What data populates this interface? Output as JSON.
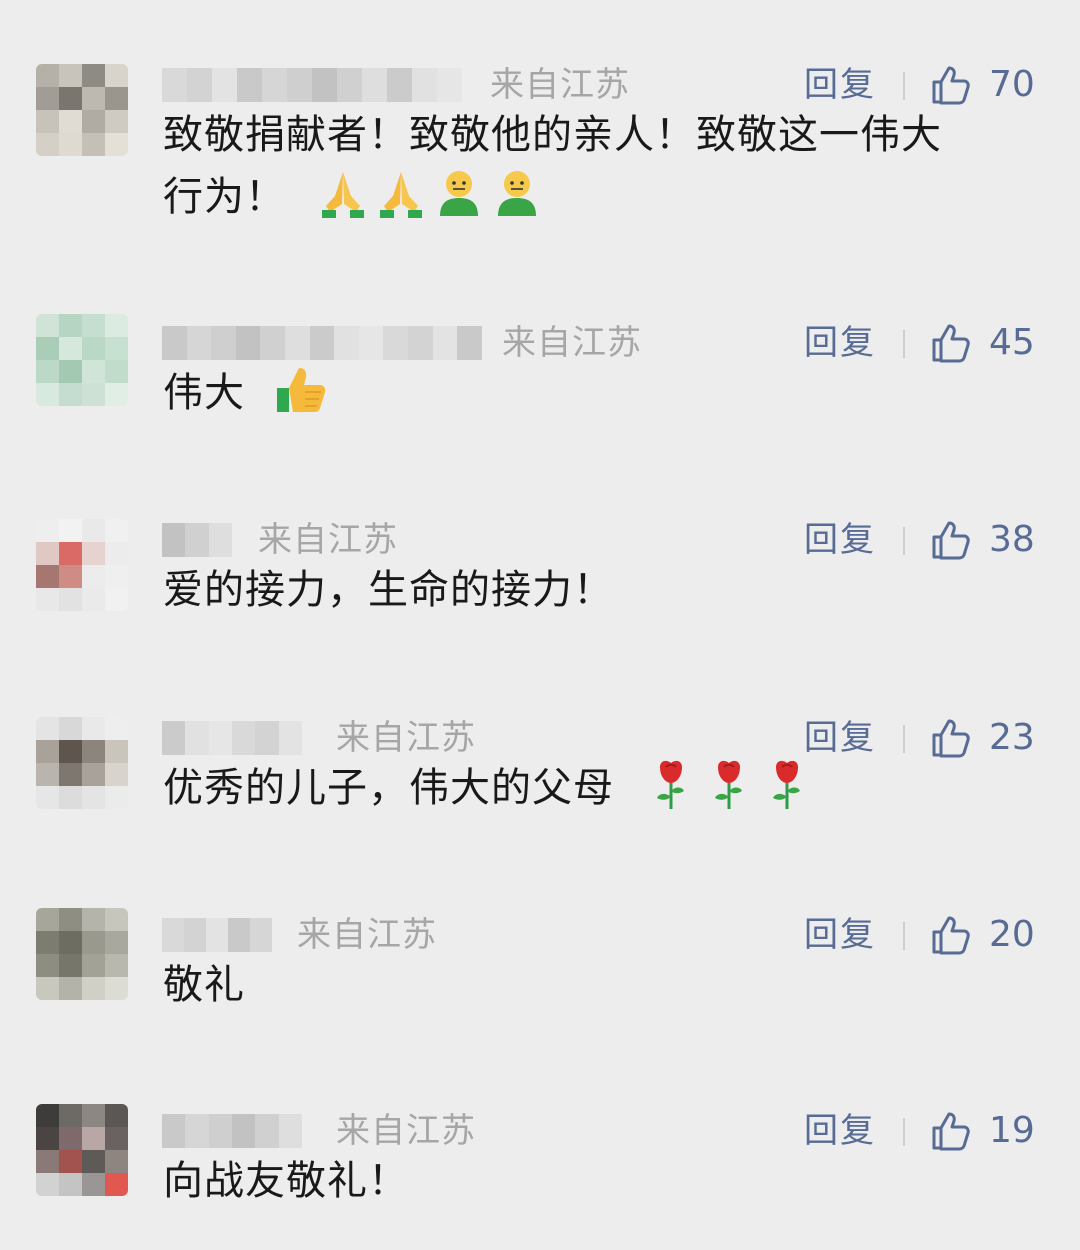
{
  "comments": [
    {
      "location": "来自江苏",
      "reply_label": "回复",
      "likes": "70",
      "text_parts": [
        "致敬捐献者！致敬他的亲人！致敬这一伟大",
        "行为！"
      ],
      "emojis": [
        "folded-hands",
        "folded-hands",
        "smiley-person",
        "smiley-person"
      ],
      "avatar_colors": [
        "#b5b1a8",
        "#c9c4bb",
        "#8e8a84",
        "#d8d4cc",
        "#a19d96",
        "#7a766f",
        "#bdb8b0",
        "#9a958d",
        "#c8c3ba",
        "#e0dcd4",
        "#b0aba3",
        "#cfcac2",
        "#d4d0c8",
        "#dedad2",
        "#c4c0b8",
        "#e4e0d8"
      ]
    },
    {
      "location": "来自江苏",
      "reply_label": "回复",
      "likes": "45",
      "text_parts": [
        "伟大"
      ],
      "emojis": [
        "thumbs-up"
      ],
      "avatar_colors": [
        "#cfe3d6",
        "#b6d6c3",
        "#c6ded0",
        "#dcebe2",
        "#a9cdb7",
        "#d6e8dc",
        "#b9d8c6",
        "#c8e0d2",
        "#bcd9c8",
        "#a3c9b2",
        "#d0e4d7",
        "#c2dccc",
        "#d8e9df",
        "#c5ddd0",
        "#cde2d5",
        "#e1eee6"
      ]
    },
    {
      "location": "来自江苏",
      "reply_label": "回复",
      "likes": "38",
      "text_parts": [
        "爱的接力，生命的接力！"
      ],
      "emojis": [],
      "avatar_colors": [
        "#eeeeee",
        "#f2f2f2",
        "#e9e9e9",
        "#f0f0f0",
        "#e0c8c4",
        "#d96a66",
        "#e6d2cf",
        "#ececec",
        "#a67670",
        "#cf8c85",
        "#ececec",
        "#efefef",
        "#e8e8e8",
        "#e2e2e2",
        "#eaeaea",
        "#f1f1f1"
      ]
    },
    {
      "location": "来自江苏",
      "reply_label": "回复",
      "likes": "23",
      "text_parts": [
        "优秀的儿子，伟大的父母"
      ],
      "emojis": [
        "rose",
        "rose",
        "rose"
      ],
      "avatar_colors": [
        "#e4e4e4",
        "#d8d8d8",
        "#e9e9e9",
        "#eeeeee",
        "#a9a29a",
        "#5e554e",
        "#8c857e",
        "#c9c4bc",
        "#b9b5ae",
        "#7e7770",
        "#a8a29a",
        "#d8d4cd",
        "#e6e6e6",
        "#dcdcdc",
        "#e4e4e4",
        "#ebebeb"
      ]
    },
    {
      "location": "来自江苏",
      "reply_label": "回复",
      "likes": "20",
      "text_parts": [
        "敬礼"
      ],
      "emojis": [],
      "avatar_colors": [
        "#a7a69b",
        "#8f8e83",
        "#b5b4aa",
        "#c7c6bd",
        "#7d7c71",
        "#6e6d62",
        "#9a998e",
        "#a9a89e",
        "#8e8d82",
        "#77766b",
        "#a3a297",
        "#b9b8ae",
        "#c9c8bf",
        "#b4b3a9",
        "#d1d0c7",
        "#dddcd4"
      ]
    },
    {
      "location": "来自江苏",
      "reply_label": "回复",
      "likes": "19",
      "text_parts": [
        "向战友敬礼！"
      ],
      "emojis": [],
      "avatar_colors": [
        "#3e3c3a",
        "#6d6a66",
        "#8c8782",
        "#5a5754",
        "#4a4543",
        "#7e6a6c",
        "#b8a7a4",
        "#6a6260",
        "#8a7a77",
        "#a3534f",
        "#5e5a58",
        "#8e8581",
        "#d2d2d2",
        "#c4c4c4",
        "#9a9695",
        "#e0584f"
      ]
    }
  ]
}
